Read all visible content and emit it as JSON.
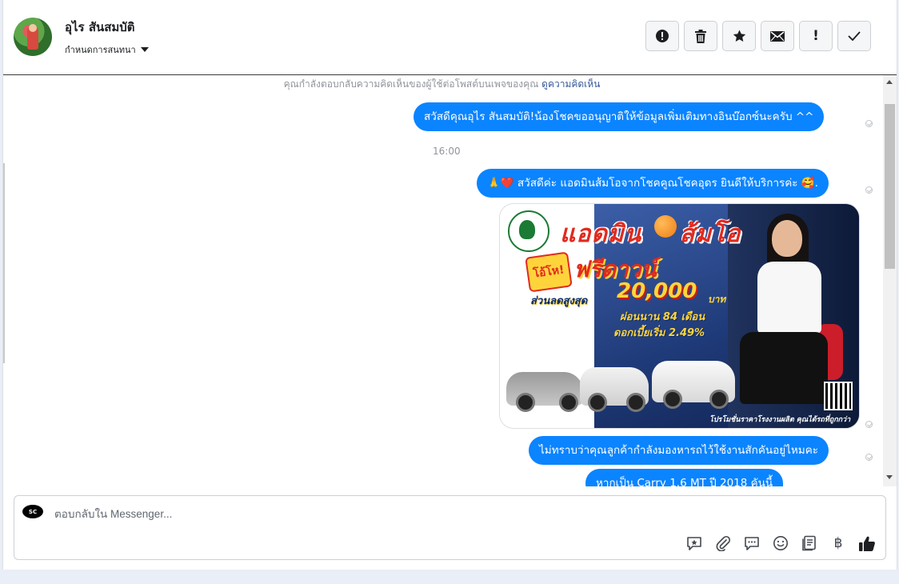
{
  "header": {
    "contact_name": "อุไร สันสมบัติ",
    "conversation_settings": "กำหนดการสนทนา",
    "toolbar_icons": [
      "alert-circle-icon",
      "trash-icon",
      "star-icon",
      "envelope-icon",
      "exclamation-icon",
      "checkmark-icon"
    ],
    "exclamation_label": "!"
  },
  "thread": {
    "notice_text": "คุณกำลังตอบกลับความคิดเห็นของผู้ใช้ต่อโพสต์บนเพจของคุณ",
    "notice_link": "ดูความคิดเห็น",
    "timestamp": "16:00",
    "messages": [
      {
        "text": "สวัสดีคุณอุไร สันสมบัติ!น้องโชคขออนุญาติให้ข้อมูลเพิ่มเติมทางอินบ๊อกซ์นะครับ ^^"
      },
      {
        "text": "สวัสดีค่ะ แอดมินส้มโอจากโชคคูณโชคอุดร ยินดีให้บริการค่ะ",
        "leading_emoji": "🙏❤️",
        "trailing_emoji": "🥰."
      },
      {
        "text": "ไม่ทราบว่าคุณลูกค้ากำลังมองหารถไว้ใช้งานสักคันอยู่ไหมคะ"
      },
      {
        "text": "หากเป็น Carry 1.6 MT  ปี 2018 คันนี้"
      }
    ],
    "promo": {
      "headline_a": "แอดมิน",
      "headline_b": "ส้มโอ",
      "badge": "โอ้โห!",
      "free_down": "ฟรีดาวน์",
      "discount_label": "ส่วนลดสูงสุด",
      "discount_amount": "20,000",
      "discount_unit": "บาท",
      "installment": "ผ่อนนาน 84 เดือน",
      "interest": "ดอกเบี้ยเริ่ม 2.49%",
      "tagline": "โปรโมชั่นราคาโรงงานผลิต คุณได้รถที่ถูกกว่า"
    }
  },
  "composer": {
    "page_avatar_text": "SC",
    "placeholder": "ตอบกลับใน Messenger...",
    "tool_icons": [
      "saved-reply-icon",
      "attachment-icon",
      "chat-bubble-icon",
      "emoji-icon",
      "notes-icon",
      "baht-icon",
      "thumbs-up-icon"
    ],
    "baht_symbol": "฿"
  },
  "colors": {
    "bubble": "#0b84ff",
    "link": "#365899",
    "muted": "#90949c"
  }
}
